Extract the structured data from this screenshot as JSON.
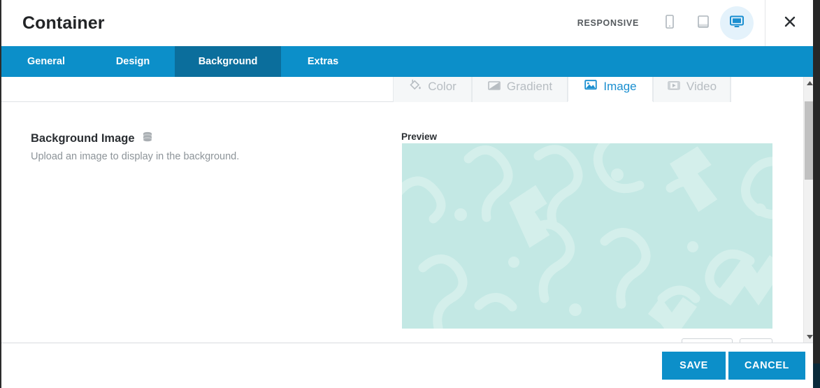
{
  "dialog": {
    "title": "Container",
    "close_icon": "close-icon"
  },
  "responsive": {
    "label": "RESPONSIVE",
    "devices": [
      {
        "name": "mobile",
        "icon": "mobile-icon",
        "active": false
      },
      {
        "name": "tablet",
        "icon": "tablet-icon",
        "active": false
      },
      {
        "name": "desktop",
        "icon": "desktop-icon",
        "active": true
      }
    ]
  },
  "tabs": [
    {
      "label": "General",
      "active": false
    },
    {
      "label": "Design",
      "active": false
    },
    {
      "label": "Background",
      "active": true
    },
    {
      "label": "Extras",
      "active": false
    }
  ],
  "subtabs": [
    {
      "label": "Color",
      "icon": "paint-bucket-icon",
      "active": false
    },
    {
      "label": "Gradient",
      "icon": "gradient-icon",
      "active": false
    },
    {
      "label": "Image",
      "icon": "image-icon",
      "active": true
    },
    {
      "label": "Video",
      "icon": "film-icon",
      "active": false
    }
  ],
  "field": {
    "label": "Background Image",
    "icon": "database-stack-icon",
    "description": "Upload an image to display in the background."
  },
  "preview": {
    "label": "Preview",
    "image_alt": "placeholder-pattern",
    "background_color": "#c3e8e4",
    "pattern_color": "#d2efeb"
  },
  "footer": {
    "save_label": "SAVE",
    "cancel_label": "CANCEL"
  },
  "scrollbar": {
    "up_arrow": "caret-up-icon",
    "down_arrow": "caret-down-icon"
  },
  "colors": {
    "accent": "#0c8fc9",
    "accent_dark": "#0b6e9c",
    "active_tab_text": "#1a8fd0",
    "muted_text": "#8d9499"
  }
}
